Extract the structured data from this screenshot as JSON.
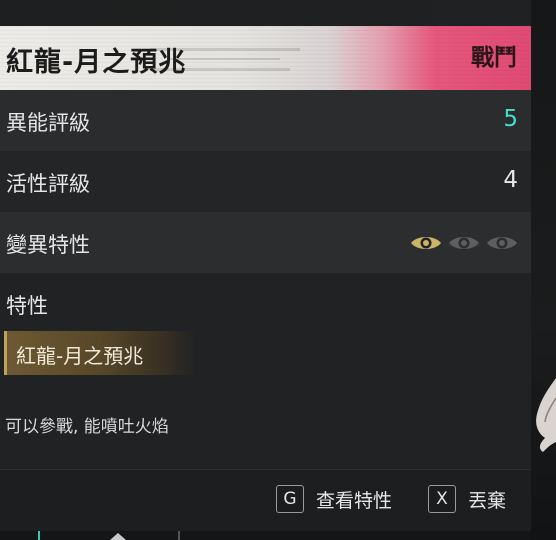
{
  "header": {
    "title": "紅龍-月之預兆",
    "tag": "戰鬥"
  },
  "stats": [
    {
      "label": "異能評級",
      "value": "5",
      "value_color": "#3fe0c5"
    },
    {
      "label": "活性評級",
      "value": "4",
      "value_color": "#e8e8e8"
    },
    {
      "label": "變異特性",
      "eyes_total": 3,
      "eyes_active": 1,
      "eye_active_color": "#c9b46a",
      "eye_inactive_color": "#5c5e5f"
    }
  ],
  "traits": {
    "title": "特性",
    "badge": "紅龍-月之預兆",
    "description": "可以參戰, 能噴吐火焰"
  },
  "actions": [
    {
      "key": "G",
      "label": "查看特性",
      "icon": "key-g-icon"
    },
    {
      "key": "X",
      "label": "丟棄",
      "icon": "key-x-icon"
    }
  ],
  "colors": {
    "header_accent": "#e04a73",
    "badge_gold": "#c0a25a",
    "teal": "#3fe0c5"
  }
}
